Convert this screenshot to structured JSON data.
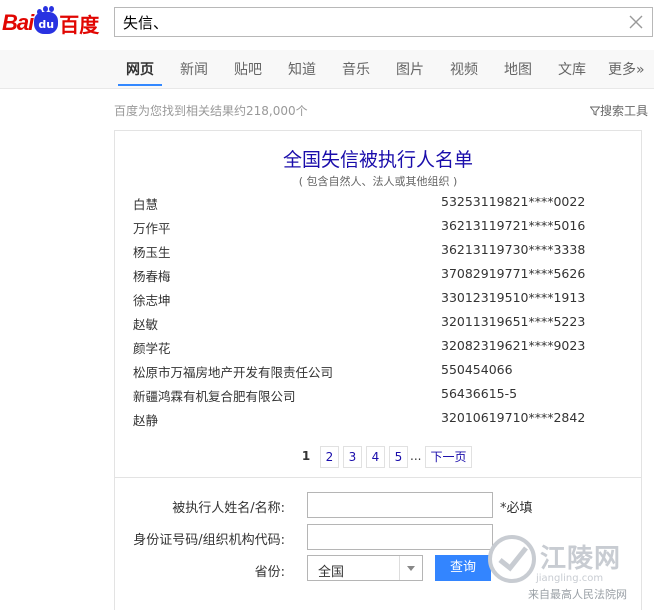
{
  "header": {
    "logo_text_bai": "Bai",
    "logo_text_du": "du",
    "logo_text_cn": "百度",
    "search_value": "失信、"
  },
  "nav": {
    "tabs": [
      {
        "label": "网页",
        "active": true
      },
      {
        "label": "新闻"
      },
      {
        "label": "贴吧"
      },
      {
        "label": "知道"
      },
      {
        "label": "音乐"
      },
      {
        "label": "图片"
      },
      {
        "label": "视频"
      },
      {
        "label": "地图"
      },
      {
        "label": "文库"
      },
      {
        "label": "更多»"
      }
    ],
    "accent": "#3388ff"
  },
  "results": {
    "count_text": "百度为您找到相关结果约218,000个",
    "tools_label": "搜索工具"
  },
  "card": {
    "title": "全国失信被执行人名单",
    "subtitle": "( 包含自然人、法人或其他组织 )",
    "rows": [
      {
        "name": "白慧",
        "id": "53253119821****0022"
      },
      {
        "name": "万作平",
        "id": "36213119721****5016"
      },
      {
        "name": "杨玉生",
        "id": "36213119730****3338"
      },
      {
        "name": "杨春梅",
        "id": "37082919771****5626"
      },
      {
        "name": "徐志坤",
        "id": "33012319510****1913"
      },
      {
        "name": "赵敏",
        "id": "32011319651****5223"
      },
      {
        "name": "颜学花",
        "id": "32082319621****9023"
      },
      {
        "name": "松原市万福房地产开发有限责任公司",
        "id": "550454066"
      },
      {
        "name": "新疆鸿霖有机复合肥有限公司",
        "id": "56436615-5"
      },
      {
        "name": "赵静",
        "id": "32010619710****2842"
      }
    ],
    "pager": {
      "pages": [
        "1",
        "2",
        "3",
        "4",
        "5"
      ],
      "ellipsis": "...",
      "next": "下一页"
    },
    "form": {
      "name_label": "被执行人姓名/名称:",
      "name_required": "*必填",
      "id_label": "身份证号码/组织机构代码:",
      "province_label": "省份:",
      "province_value": "全国",
      "query_button": "查询"
    }
  },
  "watermark": {
    "site_name": "江陵网",
    "site_domain": "jiangling.com",
    "credit": "来自最高人民法院网"
  }
}
